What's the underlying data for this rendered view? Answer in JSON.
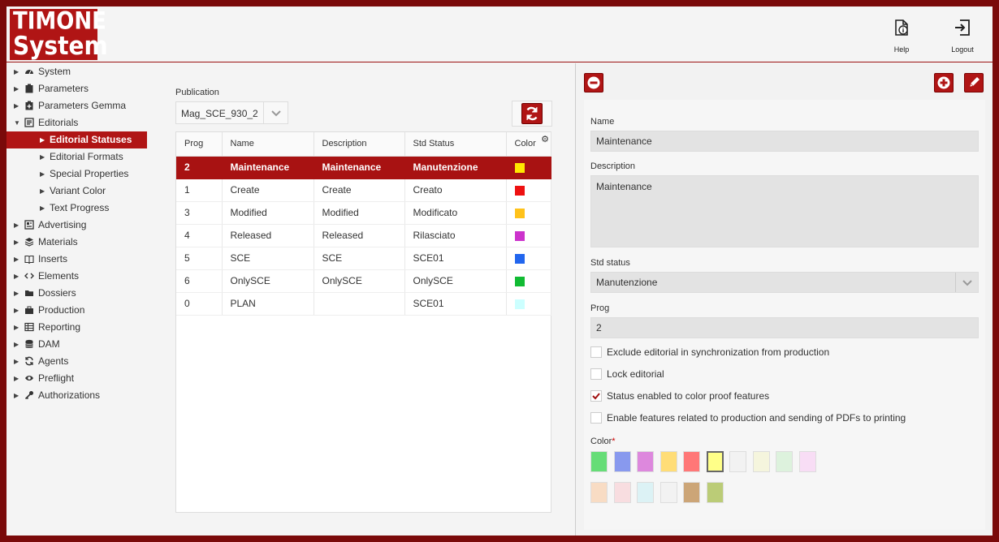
{
  "app": {
    "logo_line1": "TIMONE",
    "logo_line2": "System"
  },
  "header": {
    "help_label": "Help",
    "logout_label": "Logout"
  },
  "sidebar": {
    "items": [
      {
        "label": "System",
        "icon": "gauge-icon",
        "level": 0,
        "expanded": false
      },
      {
        "label": "Parameters",
        "icon": "clipboard-icon",
        "level": 0,
        "expanded": false
      },
      {
        "label": "Parameters Gemma",
        "icon": "clipboard-plus-icon",
        "level": 0,
        "expanded": false
      },
      {
        "label": "Editorials",
        "icon": "editorials-icon",
        "level": 0,
        "expanded": true
      },
      {
        "label": "Editorial Statuses",
        "level": 1,
        "active": true
      },
      {
        "label": "Editorial Formats",
        "level": 1
      },
      {
        "label": "Special Properties",
        "level": 1
      },
      {
        "label": "Variant Color",
        "level": 1
      },
      {
        "label": "Text Progress",
        "level": 1
      },
      {
        "label": "Advertising",
        "icon": "advertising-icon",
        "level": 0
      },
      {
        "label": "Materials",
        "icon": "layers-icon",
        "level": 0
      },
      {
        "label": "Inserts",
        "icon": "book-icon",
        "level": 0
      },
      {
        "label": "Elements",
        "icon": "code-icon",
        "level": 0
      },
      {
        "label": "Dossiers",
        "icon": "folder-icon",
        "level": 0
      },
      {
        "label": "Production",
        "icon": "briefcase-icon",
        "level": 0
      },
      {
        "label": "Reporting",
        "icon": "table-icon",
        "level": 0
      },
      {
        "label": "DAM",
        "icon": "database-icon",
        "level": 0
      },
      {
        "label": "Agents",
        "icon": "refresh-icon",
        "level": 0
      },
      {
        "label": "Preflight",
        "icon": "eye-icon",
        "level": 0
      },
      {
        "label": "Authorizations",
        "icon": "key-icon",
        "level": 0
      }
    ]
  },
  "publication": {
    "label": "Publication",
    "value": "Mag_SCE_930_2"
  },
  "grid": {
    "columns": [
      "Prog",
      "Name",
      "Description",
      "Std Status",
      "Color"
    ],
    "rows": [
      {
        "prog": "2",
        "name": "Maintenance",
        "description": "Maintenance",
        "std_status": "Manutenzione",
        "color": "#ffe800",
        "selected": true
      },
      {
        "prog": "1",
        "name": "Create",
        "description": "Create",
        "std_status": "Creato",
        "color": "#ee1111"
      },
      {
        "prog": "3",
        "name": "Modified",
        "description": "Modified",
        "std_status": "Modificato",
        "color": "#ffc21a"
      },
      {
        "prog": "4",
        "name": "Released",
        "description": "Released",
        "std_status": "Rilasciato",
        "color": "#cc33cc"
      },
      {
        "prog": "5",
        "name": "SCE",
        "description": "SCE",
        "std_status": "SCE01",
        "color": "#2266ee"
      },
      {
        "prog": "6",
        "name": "OnlySCE",
        "description": "OnlySCE",
        "std_status": "OnlySCE",
        "color": "#11bb33"
      },
      {
        "prog": "0",
        "name": "PLAN",
        "description": "",
        "std_status": "SCE01",
        "color": "#ccffff"
      }
    ]
  },
  "form": {
    "name_label": "Name",
    "name_value": "Maintenance",
    "description_label": "Description",
    "description_value": "Maintenance",
    "std_status_label": "Std status",
    "std_status_value": "Manutenzione",
    "prog_label": "Prog",
    "prog_value": "2",
    "checkboxes": [
      {
        "label": "Exclude editorial in synchronization from production",
        "checked": false
      },
      {
        "label": "Lock editorial",
        "checked": false
      },
      {
        "label": "Status enabled to color proof features",
        "checked": true
      },
      {
        "label": "Enable features related to production and sending of PDFs to printing",
        "checked": false
      }
    ],
    "color_label": "Color",
    "required_mark": "*",
    "palette": [
      [
        "#66dd77",
        "#8899ee",
        "#dd88dd",
        "#ffdd77",
        "#ff7777",
        "#ffff88",
        "#f2f2f2",
        "#f5f5dd",
        "#ddf2dd",
        "#f8ddf5"
      ],
      [
        "#f8dcc4",
        "#f8dde0",
        "#dcf2f5",
        "#f2f2f2",
        "#cca577",
        "#bbcc77"
      ]
    ],
    "selected_color": "#ffff88"
  }
}
